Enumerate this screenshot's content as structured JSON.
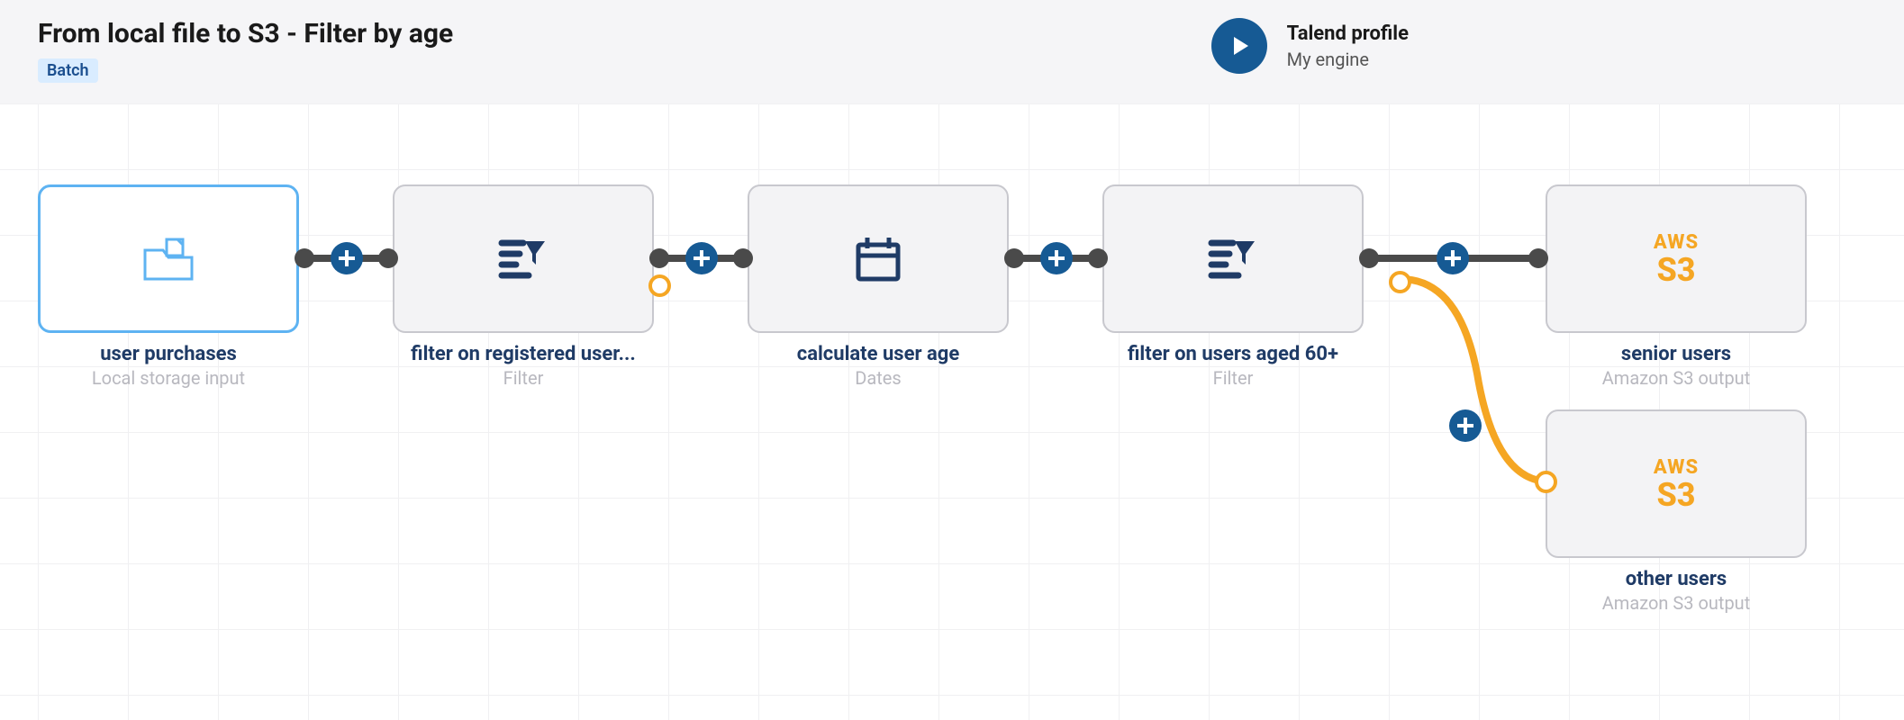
{
  "header": {
    "title": "From local file to S3 - Filter by age",
    "badge": "Batch",
    "profile_label": "Talend profile",
    "profile_value": "My engine"
  },
  "nodes": {
    "n1": {
      "title": "user purchases",
      "sub": "Local storage input",
      "icon": "local-file-input"
    },
    "n2": {
      "title": "filter on registered user...",
      "sub": "Filter",
      "icon": "filter"
    },
    "n3": {
      "title": "calculate user age",
      "sub": "Dates",
      "icon": "dates"
    },
    "n4": {
      "title": "filter on users aged 60+",
      "sub": "Filter",
      "icon": "filter"
    },
    "n5": {
      "title": "senior users",
      "sub": "Amazon S3 output",
      "icon": "aws-s3"
    },
    "n6": {
      "title": "other users",
      "sub": "Amazon S3 output",
      "icon": "aws-s3"
    }
  },
  "s3_label": {
    "aws": "AWS",
    "s3": "S3"
  },
  "connections": [
    {
      "from": "n1",
      "to": "n2",
      "type": "main"
    },
    {
      "from": "n2",
      "to": "n3",
      "type": "main"
    },
    {
      "from": "n3",
      "to": "n4",
      "type": "main"
    },
    {
      "from": "n4",
      "to": "n5",
      "type": "main"
    },
    {
      "from": "n4",
      "to": "n6",
      "type": "reject"
    }
  ]
}
